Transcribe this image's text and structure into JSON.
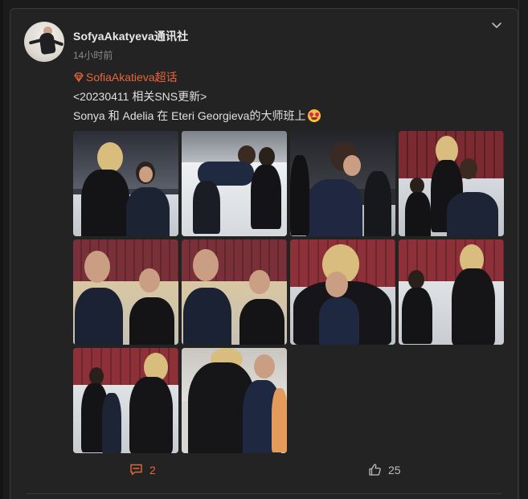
{
  "post": {
    "username": "SofyaAkatyeva通讯社",
    "timestamp": "14小时前",
    "topic": "SofiaAkatieva超话",
    "line1": "<20230411 相关SNS更新>",
    "line2": "Sonya 和 Adelia 在 Eteri Georgieva的大师班上",
    "emoji": "heart-eyes-emoji",
    "photo_count": 10
  },
  "actions": {
    "comment_count": "2",
    "like_count": "25"
  },
  "colors": {
    "accent": "#e8663a",
    "card_bg": "#232324",
    "page_bg": "#1b1b1c"
  }
}
